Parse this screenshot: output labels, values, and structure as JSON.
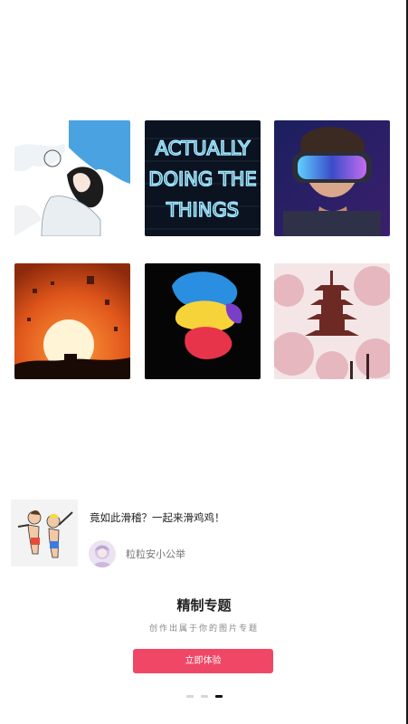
{
  "gallery": {
    "images": [
      {
        "icon": "anime-girl-sky-illustration"
      },
      {
        "icon": "neon-sign-actually-doing-the-things",
        "text_lines": [
          "ACTUALLY",
          "DOING THE",
          "THINGS"
        ]
      },
      {
        "icon": "vr-headset-boy-portrait"
      },
      {
        "icon": "sunset-lanterns-silhouette"
      },
      {
        "icon": "colorful-smoke-ink-cloud"
      },
      {
        "icon": "pagoda-cherry-blossoms"
      }
    ]
  },
  "feature_card": {
    "title": "竟如此滑稽？一起来滑鸡鸡！",
    "thumbnail_icon": "cartoon-dab-characters",
    "author": {
      "name": "粒粒安小公举",
      "avatar_icon": "user-avatar"
    }
  },
  "promo": {
    "heading": "精制专题",
    "subheading": "创作出属于你的图片专题",
    "button_label": "立即体验",
    "button_color": "#f04766"
  },
  "pager": {
    "count": 3,
    "active_index": 2
  }
}
